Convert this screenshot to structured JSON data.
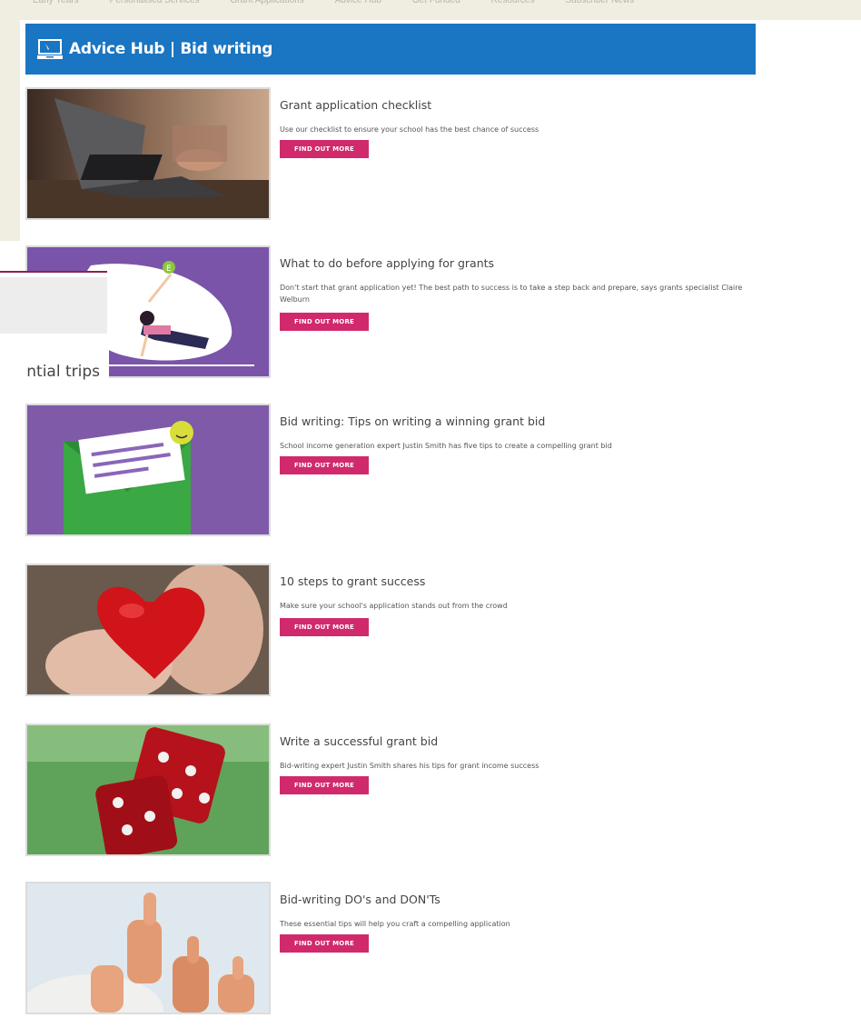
{
  "topnav": [
    "Early Years",
    "Personalised Services",
    "Grant Applications",
    "Advice Hub",
    "Get Funded",
    "Resources",
    "Subscriber News"
  ],
  "header": {
    "title": "Advice Hub | Bid writing",
    "icon": "laptop-icon"
  },
  "articles": [
    {
      "title": "Grant application checklist",
      "desc": "Use our checklist to ensure your school has the best chance of success",
      "button": "FIND OUT MORE",
      "image": "laptop-photo"
    },
    {
      "title": "What to do before applying for grants",
      "desc": "Don't start that grant application yet! The best path to success is to take a step back and prepare, says grants specialist Claire Welburn",
      "button": "FIND OUT MORE",
      "image": "yoga-illustration"
    },
    {
      "title": "Bid writing: Tips on writing a winning grant bid",
      "desc": "School income generation expert Justin Smith has five tips to create a compelling grant bid",
      "button": "FIND OUT MORE",
      "image": "envelope-illustration"
    },
    {
      "title": "10 steps to grant success",
      "desc": "Make sure your school's application stands out from the crowd",
      "button": "FIND OUT MORE",
      "image": "heart-hands-photo"
    },
    {
      "title": "Write a successful grant bid",
      "desc": "Bid-writing expert Justin Smith shares his tips for grant income success",
      "button": "FIND OUT MORE",
      "image": "dice-photo"
    },
    {
      "title": "Bid-writing DO's and DON'Ts",
      "desc": "These essential tips will help you craft a compelling application",
      "button": "FIND OUT MORE",
      "image": "thumbs-up-photo"
    }
  ],
  "overlay": {
    "text": "ntial trips"
  },
  "colors": {
    "header_bg": "#1a75c2",
    "button_bg": "#d12a6c",
    "frame": "#efeee0",
    "overlay_line": "#8b2252"
  }
}
